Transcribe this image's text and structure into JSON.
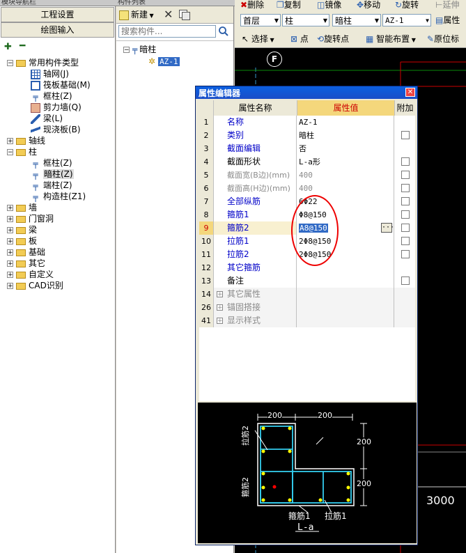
{
  "nav_panel": {
    "title": "模块导航栏",
    "btn_settings": "工程设置",
    "btn_drawing": "绘图输入",
    "tree": [
      {
        "label": "常用构件类型",
        "indent": 0,
        "kind": "folder-open",
        "exp": "-"
      },
      {
        "label": "轴网(J)",
        "indent": 1,
        "kind": "grid"
      },
      {
        "label": "筏板基础(M)",
        "indent": 1,
        "kind": "raft"
      },
      {
        "label": "框柱(Z)",
        "indent": 1,
        "kind": "col"
      },
      {
        "label": "剪力墙(Q)",
        "indent": 1,
        "kind": "wall"
      },
      {
        "label": "梁(L)",
        "indent": 1,
        "kind": "beam"
      },
      {
        "label": "现浇板(B)",
        "indent": 1,
        "kind": "slab"
      },
      {
        "label": "轴线",
        "indent": 0,
        "kind": "folder",
        "exp": "+"
      },
      {
        "label": "柱",
        "indent": 0,
        "kind": "folder-open",
        "exp": "-"
      },
      {
        "label": "框柱(Z)",
        "indent": 1,
        "kind": "col"
      },
      {
        "label": "暗柱(Z)",
        "indent": 1,
        "kind": "col",
        "selected": true
      },
      {
        "label": "端柱(Z)",
        "indent": 1,
        "kind": "col"
      },
      {
        "label": "构造柱(Z1)",
        "indent": 1,
        "kind": "col2"
      },
      {
        "label": "墙",
        "indent": 0,
        "kind": "folder",
        "exp": "+"
      },
      {
        "label": "门窗洞",
        "indent": 0,
        "kind": "folder",
        "exp": "+"
      },
      {
        "label": "梁",
        "indent": 0,
        "kind": "folder",
        "exp": "+"
      },
      {
        "label": "板",
        "indent": 0,
        "kind": "folder",
        "exp": "+"
      },
      {
        "label": "基础",
        "indent": 0,
        "kind": "folder",
        "exp": "+"
      },
      {
        "label": "其它",
        "indent": 0,
        "kind": "folder",
        "exp": "+"
      },
      {
        "label": "自定义",
        "indent": 0,
        "kind": "folder",
        "exp": "+"
      },
      {
        "label": "CAD识别",
        "indent": 0,
        "kind": "folder",
        "exp": "+"
      }
    ]
  },
  "list_panel": {
    "title": "构件列表",
    "btn_new": "新建",
    "search_placeholder": "搜索构件...",
    "tree_root": "暗柱",
    "tree_child": "AZ-1"
  },
  "toolbar": {
    "delete": "删除",
    "copy": "复制",
    "mirror": "镜像",
    "move": "移动",
    "rotate": "旋转",
    "extend": "延伸",
    "combo_floor": "首层",
    "combo_type": "柱",
    "combo_sub": "暗柱",
    "combo_item": "AZ-1",
    "prop_btn": "属性",
    "select": "选择",
    "point": "点",
    "rotate_point": "旋转点",
    "smart_layout": "智能布置",
    "original_pos": "原位标"
  },
  "canvas": {
    "axis_label": "F",
    "dimension": "3000"
  },
  "dialog": {
    "title": "属性编辑器",
    "col_name": "属性名称",
    "col_value": "属性值",
    "col_extra": "附加",
    "rows": [
      {
        "num": "1",
        "name": "名称",
        "value": "AZ-1",
        "style": "blue",
        "chk": false
      },
      {
        "num": "2",
        "name": "类别",
        "value": "暗柱",
        "style": "blue",
        "chk": true
      },
      {
        "num": "3",
        "name": "截面编辑",
        "value": "否",
        "style": "blue",
        "chk": false
      },
      {
        "num": "4",
        "name": "截面形状",
        "value": "L-a形",
        "style": "black",
        "chk": true
      },
      {
        "num": "5",
        "name": "截面宽(B边)(mm)",
        "value": "400",
        "style": "gray",
        "chk": true
      },
      {
        "num": "6",
        "name": "截面高(H边)(mm)",
        "value": "400",
        "style": "gray",
        "chk": true
      },
      {
        "num": "7",
        "name": "全部纵筋",
        "value": "6Φ22",
        "style": "blue",
        "chk": true
      },
      {
        "num": "8",
        "name": "箍筋1",
        "value": "Φ8@150",
        "style": "blue",
        "chk": true
      },
      {
        "num": "9",
        "name": "箍筋2",
        "value": "A8@150",
        "style": "blue",
        "chk": true,
        "editing": true
      },
      {
        "num": "10",
        "name": "拉筋1",
        "value": "2Φ8@150",
        "style": "blue",
        "chk": true
      },
      {
        "num": "11",
        "name": "拉筋2",
        "value": "2Φ8@150",
        "style": "blue",
        "chk": true
      },
      {
        "num": "12",
        "name": "其它箍筋",
        "value": "",
        "style": "blue",
        "chk": false
      },
      {
        "num": "13",
        "name": "备注",
        "value": "",
        "style": "black",
        "chk": true
      },
      {
        "num": "14",
        "name": "其它属性",
        "value": "",
        "style": "gray",
        "chk": false,
        "group": true
      },
      {
        "num": "26",
        "name": "锚固搭接",
        "value": "",
        "style": "gray",
        "chk": false,
        "group": true
      },
      {
        "num": "41",
        "name": "显示样式",
        "value": "",
        "style": "gray",
        "chk": false,
        "group": true
      }
    ],
    "diagram": {
      "dim_top_left": "200",
      "dim_top_right": "200",
      "dim_right_top": "200",
      "dim_right_bottom": "200",
      "label_lajin2": "拉筋2",
      "label_gujin2": "箍筋2",
      "label_gujin1": "箍筋1",
      "label_lajin1": "拉筋1",
      "shape_name": "L-a"
    }
  }
}
